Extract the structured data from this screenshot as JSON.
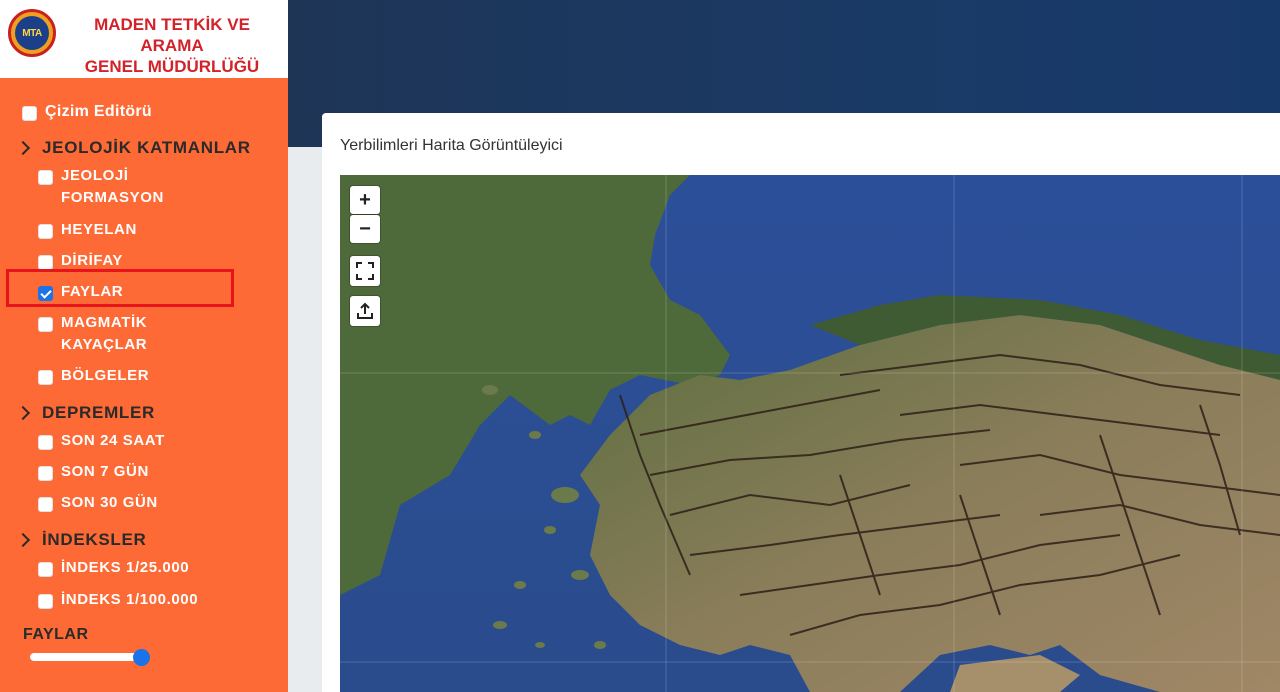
{
  "logo": {
    "emblem": "MTA",
    "line1": "MADEN TETKİK VE ARAMA",
    "line2": "GENEL MÜDÜRLÜĞÜ"
  },
  "menu": {
    "editor": {
      "label": "Çizim Editörü",
      "checked": false
    },
    "sections": [
      {
        "title": "JEOLOJİK KATMANLAR",
        "items": [
          {
            "label": "JEOLOJİ",
            "label2": "FORMASYON",
            "checked": false
          },
          {
            "label": "HEYELAN",
            "checked": false
          },
          {
            "label": "DİRİFAY",
            "checked": false
          },
          {
            "label": "FAYLAR",
            "checked": true
          },
          {
            "label": "MAGMATİK",
            "label2": "KAYAÇLAR",
            "checked": false
          },
          {
            "label": "BÖLGELER",
            "checked": false
          }
        ]
      },
      {
        "title": "DEPREMLER",
        "items": [
          {
            "label": "SON 24 SAAT",
            "checked": false
          },
          {
            "label": "SON 7 GÜN",
            "checked": false
          },
          {
            "label": "SON 30 GÜN",
            "checked": false
          }
        ]
      },
      {
        "title": "İNDEKSLER",
        "items": [
          {
            "label": "İNDEKS 1/25.000",
            "checked": false
          },
          {
            "label": "İNDEKS 1/100.000",
            "checked": false
          }
        ]
      }
    ]
  },
  "opacity": {
    "label": "FAYLAR",
    "value": 1.0
  },
  "viewer": {
    "title": "Yerbilimleri Harita Görüntüleyici",
    "controls": {
      "zoom_in": "+",
      "zoom_out": "−",
      "fullscreen_icon": "fullscreen-icon",
      "export_icon": "upload-icon"
    }
  },
  "colors": {
    "sidebar": "#fd6a35",
    "header": "#1a3a66",
    "accent": "#1a73e8",
    "highlight": "#e8141c",
    "logo_text": "#d3222a"
  }
}
